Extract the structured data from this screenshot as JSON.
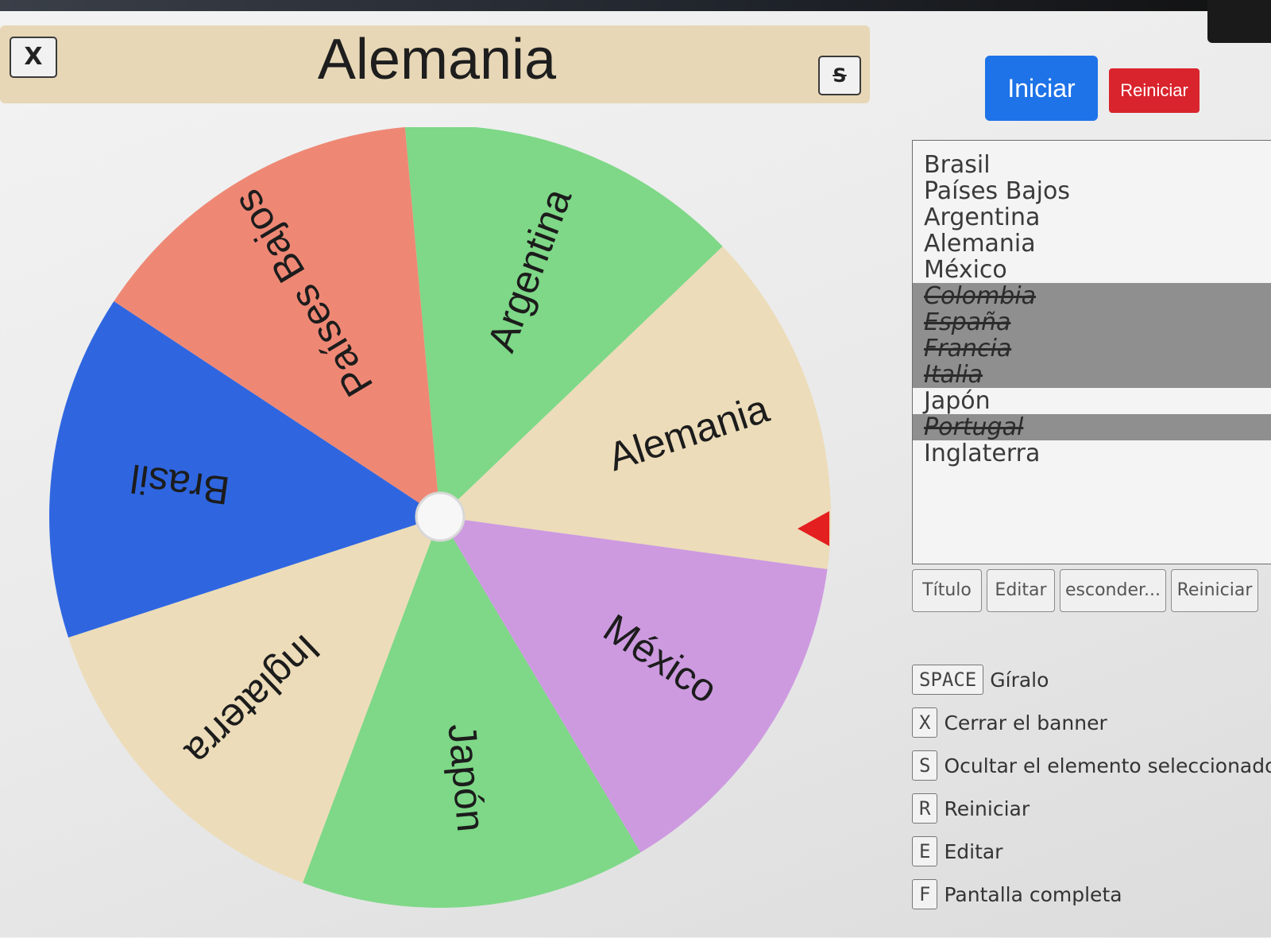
{
  "banner": {
    "close_key": "X",
    "title": "Alemania",
    "hide_key": "S"
  },
  "controls": {
    "start_label": "Iniciar",
    "reset_label": "Reiniciar"
  },
  "entries": [
    {
      "label": "Brasil",
      "hidden": false
    },
    {
      "label": "Países Bajos",
      "hidden": false
    },
    {
      "label": "Argentina",
      "hidden": false
    },
    {
      "label": "Alemania",
      "hidden": false
    },
    {
      "label": "México",
      "hidden": false
    },
    {
      "label": "Colombia",
      "hidden": true
    },
    {
      "label": "España",
      "hidden": true
    },
    {
      "label": "Francia",
      "hidden": true
    },
    {
      "label": "Italia",
      "hidden": true
    },
    {
      "label": "Japón",
      "hidden": false
    },
    {
      "label": "Portugal",
      "hidden": true
    },
    {
      "label": "Inglaterra",
      "hidden": false
    }
  ],
  "toolbar": {
    "title_label": "Título",
    "edit_label": "Editar",
    "hide_label": "esconder...",
    "reset_label": "Reiniciar"
  },
  "shortcuts": [
    {
      "key": "SPACE",
      "desc": "Gíralo"
    },
    {
      "key": "X",
      "desc": "Cerrar el banner"
    },
    {
      "key": "S",
      "desc": "Ocultar el elemento seleccionado"
    },
    {
      "key": "R",
      "desc": "Reiniciar"
    },
    {
      "key": "E",
      "desc": "Editar"
    },
    {
      "key": "F",
      "desc": "Pantalla completa"
    }
  ],
  "wheel": {
    "segments": [
      {
        "label": "Alemania",
        "color": "#ecdcb9"
      },
      {
        "label": "México",
        "color": "#cd9ae0"
      },
      {
        "label": "Japón",
        "color": "#7ed887"
      },
      {
        "label": "Inglaterra",
        "color": "#ecdcb9"
      },
      {
        "label": "Brasil",
        "color": "#2f66e0"
      },
      {
        "label": "Países Bajos",
        "color": "#ee8875"
      },
      {
        "label": "Argentina",
        "color": "#7ed887"
      }
    ],
    "selected": "Alemania",
    "pointer_color": "#e41f1f"
  }
}
